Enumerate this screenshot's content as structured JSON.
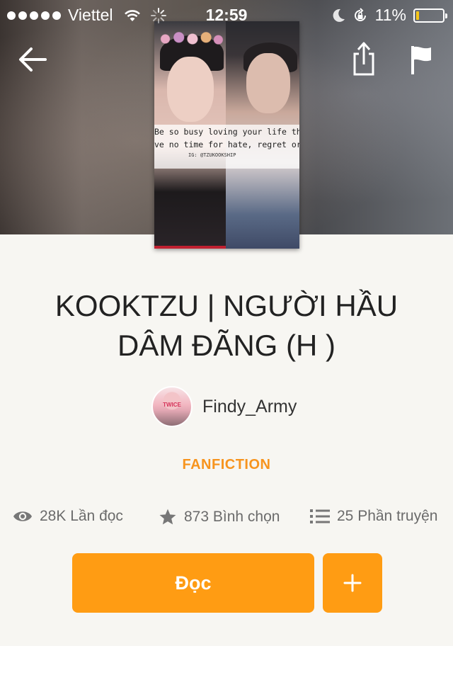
{
  "status_bar": {
    "carrier": "Viettel",
    "time": "12:59",
    "battery_percent": "11%",
    "battery_level": 0.11,
    "battery_color": "#f5c518"
  },
  "nav": {
    "back_icon": "arrow-left-icon",
    "share_icon": "share-icon",
    "report_icon": "flag-icon"
  },
  "cover": {
    "quote_line1": "Be so busy loving your life that y",
    "quote_line2": "ve no time for hate, regret or fe",
    "credit": "IG: @TZUKOOKSHIP"
  },
  "story": {
    "title_line1": "KOOKTZU | NGƯỜI HẦU",
    "title_line2": "DÂM ĐÃNG (H )",
    "author": "Findy_Army",
    "category": "FANFICTION"
  },
  "stats": {
    "reads": "28K Lần đọc",
    "votes": "873 Bình chọn",
    "parts": "25 Phần truyện"
  },
  "actions": {
    "read_label": "Đọc",
    "add_icon": "plus-icon"
  },
  "colors": {
    "accent": "#ff9c13",
    "category": "#f7941e",
    "panel_bg": "#f7f6f2"
  }
}
